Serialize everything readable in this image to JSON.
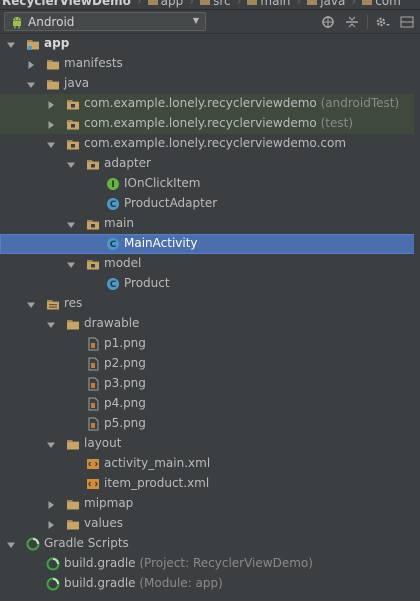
{
  "breadcrumbs": [
    "RecyclerViewDemo",
    "app",
    "src",
    "main",
    "java",
    "com"
  ],
  "dropdown": {
    "selected": "Android"
  },
  "toolbar_icons": [
    "crosshair-icon",
    "collapse-all-icon",
    "settings-icon",
    "hide-panel-icon"
  ],
  "tree": [
    {
      "label": "app",
      "bold": true,
      "indent": 0,
      "arrow": "down",
      "icon": "module-folder"
    },
    {
      "label": "manifests",
      "indent": 1,
      "arrow": "right",
      "icon": "folder"
    },
    {
      "label": "java",
      "indent": 1,
      "arrow": "down",
      "icon": "folder"
    },
    {
      "label": "com.example.lonely.recyclerviewdemo",
      "suffix": "(androidTest)",
      "indent": 2,
      "arrow": "right",
      "icon": "package",
      "test": true
    },
    {
      "label": "com.example.lonely.recyclerviewdemo",
      "suffix": "(test)",
      "indent": 2,
      "arrow": "right",
      "icon": "package",
      "test": true
    },
    {
      "label": "com.example.lonely.recyclerviewdemo.com",
      "indent": 2,
      "arrow": "down",
      "icon": "package"
    },
    {
      "label": "adapter",
      "indent": 3,
      "arrow": "down",
      "icon": "package"
    },
    {
      "label": "IOnClickItem",
      "indent": 4,
      "icon": "interface"
    },
    {
      "label": "ProductAdapter",
      "indent": 4,
      "icon": "class"
    },
    {
      "label": "main",
      "indent": 3,
      "arrow": "down",
      "icon": "package"
    },
    {
      "label": "MainActivity",
      "indent": 4,
      "icon": "class",
      "selected": true
    },
    {
      "label": "model",
      "indent": 3,
      "arrow": "down",
      "icon": "package"
    },
    {
      "label": "Product",
      "indent": 4,
      "icon": "class"
    },
    {
      "label": "res",
      "indent": 1,
      "arrow": "down",
      "icon": "res-folder"
    },
    {
      "label": "drawable",
      "indent": 2,
      "arrow": "down",
      "icon": "folder"
    },
    {
      "label": "p1.png",
      "indent": 3,
      "icon": "image-file"
    },
    {
      "label": "p2.png",
      "indent": 3,
      "icon": "image-file"
    },
    {
      "label": "p3.png",
      "indent": 3,
      "icon": "image-file"
    },
    {
      "label": "p4.png",
      "indent": 3,
      "icon": "image-file"
    },
    {
      "label": "p5.png",
      "indent": 3,
      "icon": "image-file"
    },
    {
      "label": "layout",
      "indent": 2,
      "arrow": "down",
      "icon": "folder"
    },
    {
      "label": "activity_main.xml",
      "indent": 3,
      "icon": "xml-file"
    },
    {
      "label": "item_product.xml",
      "indent": 3,
      "icon": "xml-file"
    },
    {
      "label": "mipmap",
      "indent": 2,
      "arrow": "right",
      "icon": "folder"
    },
    {
      "label": "values",
      "indent": 2,
      "arrow": "right",
      "icon": "folder"
    },
    {
      "label": "Gradle Scripts",
      "indent": 0,
      "arrow": "down",
      "icon": "gradle"
    },
    {
      "label": "build.gradle",
      "suffix": "(Project: RecyclerViewDemo)",
      "indent": 1,
      "icon": "gradle"
    },
    {
      "label": "build.gradle",
      "suffix": "(Module: app)",
      "indent": 1,
      "icon": "gradle"
    }
  ],
  "colors": {
    "background": "#3c3f41",
    "selection": "#4b6eaf",
    "folder": "#a3865c",
    "class_icon": "#4a9bc7",
    "interface_icon": "#62b543",
    "gradle": "#3ea53e"
  }
}
